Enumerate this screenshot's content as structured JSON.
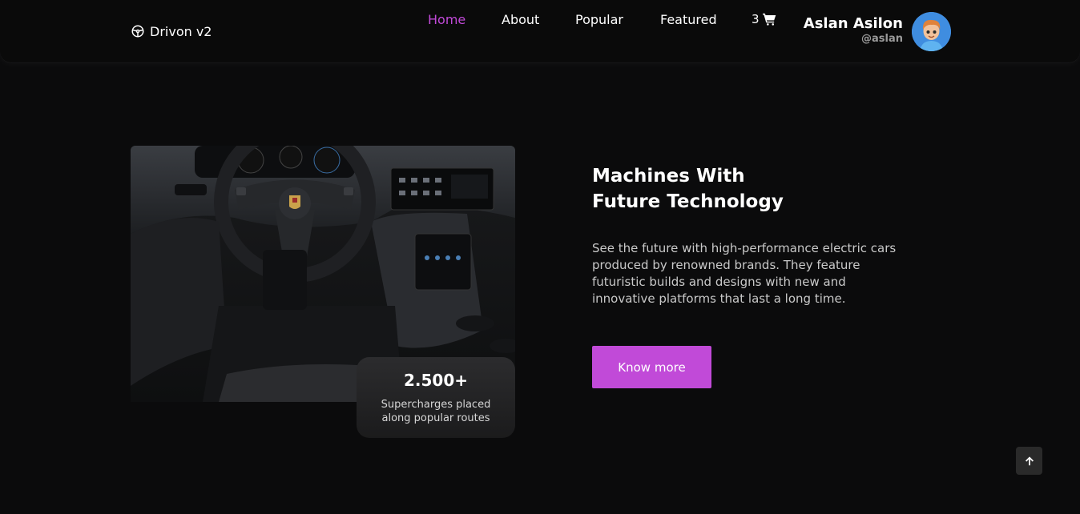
{
  "brand": {
    "name": "Drivon v2",
    "icon": "steering-wheel-icon"
  },
  "nav": {
    "items": [
      {
        "label": "Home",
        "active": true
      },
      {
        "label": "About",
        "active": false
      },
      {
        "label": "Popular",
        "active": false
      },
      {
        "label": "Featured",
        "active": false
      }
    ]
  },
  "cart": {
    "count": "3",
    "icon": "cart-icon"
  },
  "user": {
    "name": "Aslan Asilon",
    "handle": "@aslan"
  },
  "hero": {
    "stat_number": "2.500+",
    "stat_label": "Supercharges placed along popular routes",
    "title_line1": "Machines With",
    "title_line2": "Future Technology",
    "description": "See the future with high-performance electric cars produced by renowned brands. They feature futuristic builds and designs with new and innovative platforms that last a long time.",
    "cta_label": "Know more"
  },
  "colors": {
    "accent": "#c14ad8",
    "background": "#0b0b0c"
  }
}
